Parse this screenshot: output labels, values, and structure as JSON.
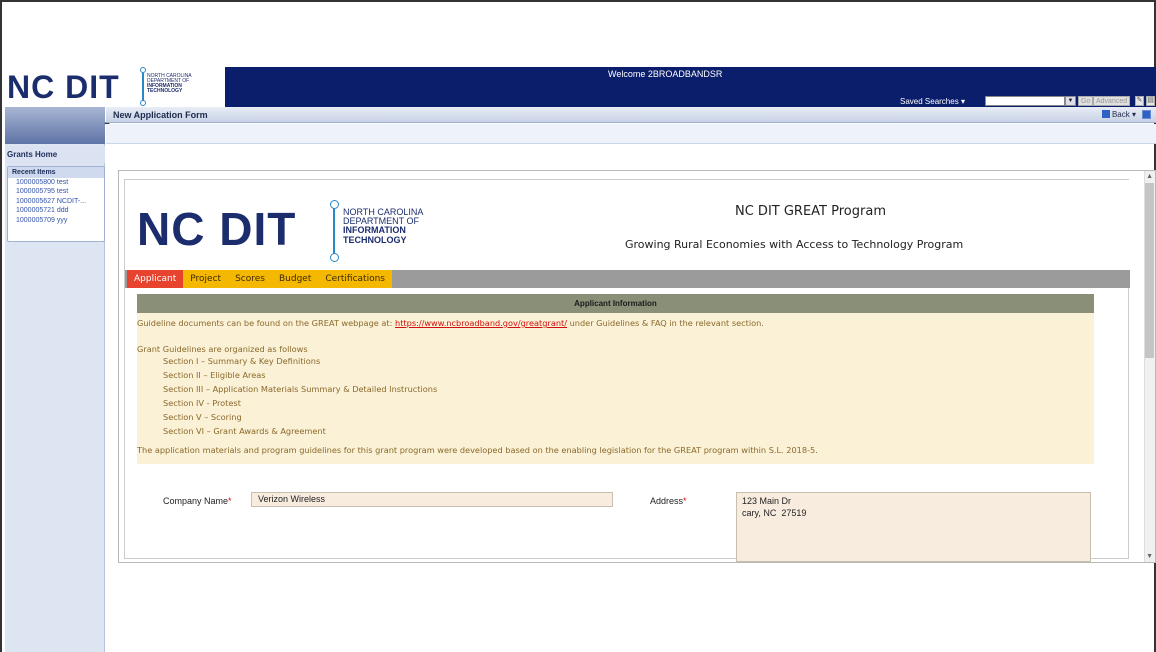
{
  "header": {
    "logo": {
      "main": "NC DIT",
      "line1": "NORTH CAROLINA",
      "line2": "DEPARTMENT OF",
      "line3": "INFORMATION",
      "line4": "TECHNOLOGY"
    },
    "welcome": "Welcome 2BROADBANDSR",
    "saved_searches": "Saved Searches",
    "search_placeholder": "",
    "go": "Go",
    "advanced": "Advanced"
  },
  "nav": {
    "grants_home": "Grants Home",
    "recent_title": "Recent Items",
    "recent_items": [
      "1000005800 test",
      "1000005795 test",
      "1000005627 NCDIT-...",
      "1000005721 ddd",
      "1000005709 yyy"
    ]
  },
  "titlebar": {
    "title": "New Application Form",
    "back": "Back"
  },
  "banner": {
    "program_title": "NC DIT GREAT Program",
    "program_subtitle": "Growing Rural Economies with Access to Technology Program"
  },
  "tabs": [
    "Applicant",
    "Project",
    "Scores",
    "Budget",
    "Certifications"
  ],
  "panel": {
    "heading": "Applicant Information",
    "guide_prefix": "Guideline documents can be found on the GREAT webpage at: ",
    "guide_link": "https://www.ncbroadband.gov/greatgrant/",
    "guide_suffix": " under Guidelines & FAQ in the relevant section.",
    "organized": "Grant Guidelines are organized as follows",
    "sections": [
      "Section I – Summary & Key Definitions",
      "Section II – Eligible Areas",
      "Section III – Application Materials Summary & Detailed Instructions",
      "Section IV - Protest",
      "Section V – Scoring",
      "Section VI – Grant Awards & Agreement"
    ],
    "legislation": "The application materials and program guidelines for this grant program were developed based on the enabling legislation for the GREAT program within S.L. 2018-5."
  },
  "form": {
    "company_label": "Company Name",
    "company_value": "Verizon Wireless",
    "address_label": "Address",
    "address_line1": "123 Main Dr",
    "address_line2": "cary, NC  27519",
    "required_mark": "*"
  },
  "colors": {
    "header_navy": "#0b1e6b",
    "tab_yellow": "#f5b800",
    "tab_active": "#e8432e",
    "panel_bg": "#fbf1d6",
    "link_red": "#d0100e"
  }
}
